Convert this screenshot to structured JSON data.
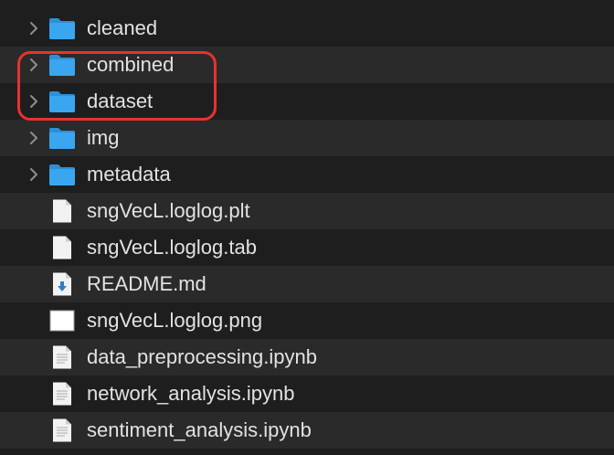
{
  "colors": {
    "background": "#1e1e1e",
    "row_alt": "#2a2a2a",
    "text": "#e2e2e2",
    "folder": "#3aa6f0",
    "highlight": "#e8322f"
  },
  "files": [
    {
      "name": "cleaned",
      "type": "folder",
      "icon": "folder-icon",
      "expandable": true
    },
    {
      "name": "combined",
      "type": "folder",
      "icon": "folder-icon",
      "expandable": true
    },
    {
      "name": "dataset",
      "type": "folder",
      "icon": "folder-icon",
      "expandable": true
    },
    {
      "name": "img",
      "type": "folder",
      "icon": "folder-icon",
      "expandable": true
    },
    {
      "name": "metadata",
      "type": "folder",
      "icon": "folder-icon",
      "expandable": true
    },
    {
      "name": "sngVecL.loglog.plt",
      "type": "document",
      "icon": "blank-document-icon",
      "expandable": false
    },
    {
      "name": "sngVecL.loglog.tab",
      "type": "document",
      "icon": "blank-document-icon",
      "expandable": false
    },
    {
      "name": "README.md",
      "type": "markdown",
      "icon": "markdown-download-icon",
      "expandable": false
    },
    {
      "name": "sngVecL.loglog.png",
      "type": "image",
      "icon": "image-thumbnail-icon",
      "expandable": false
    },
    {
      "name": "data_preprocessing.ipynb",
      "type": "notebook",
      "icon": "text-document-icon",
      "expandable": false
    },
    {
      "name": "network_analysis.ipynb",
      "type": "notebook",
      "icon": "text-document-icon",
      "expandable": false
    },
    {
      "name": "sentiment_analysis.ipynb",
      "type": "notebook",
      "icon": "text-document-icon",
      "expandable": false
    }
  ]
}
